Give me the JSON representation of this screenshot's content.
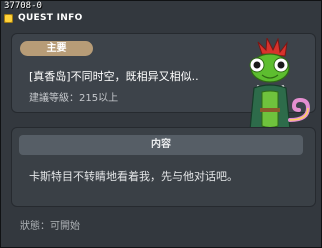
{
  "window": {
    "quest_id": "37708-0",
    "title": "QUEST INFO"
  },
  "quest": {
    "badge_label": "主要",
    "name": "[真香岛]不同时空，既相异又相似..",
    "level_requirement": "建議等級：215以上"
  },
  "content": {
    "header": "内容",
    "text": "卡斯特目不转睛地看着我，先与他对话吧。"
  },
  "status": {
    "text": "狀態：可開始"
  },
  "icons": {
    "title_icon": "quest-window-icon",
    "mascot": "chameleon-mascot-icon"
  },
  "colors": {
    "window_bg": "#33383e",
    "badge_bg": "#b79c77",
    "header_bg": "#565e66",
    "mascot_green": "#57b82d"
  }
}
